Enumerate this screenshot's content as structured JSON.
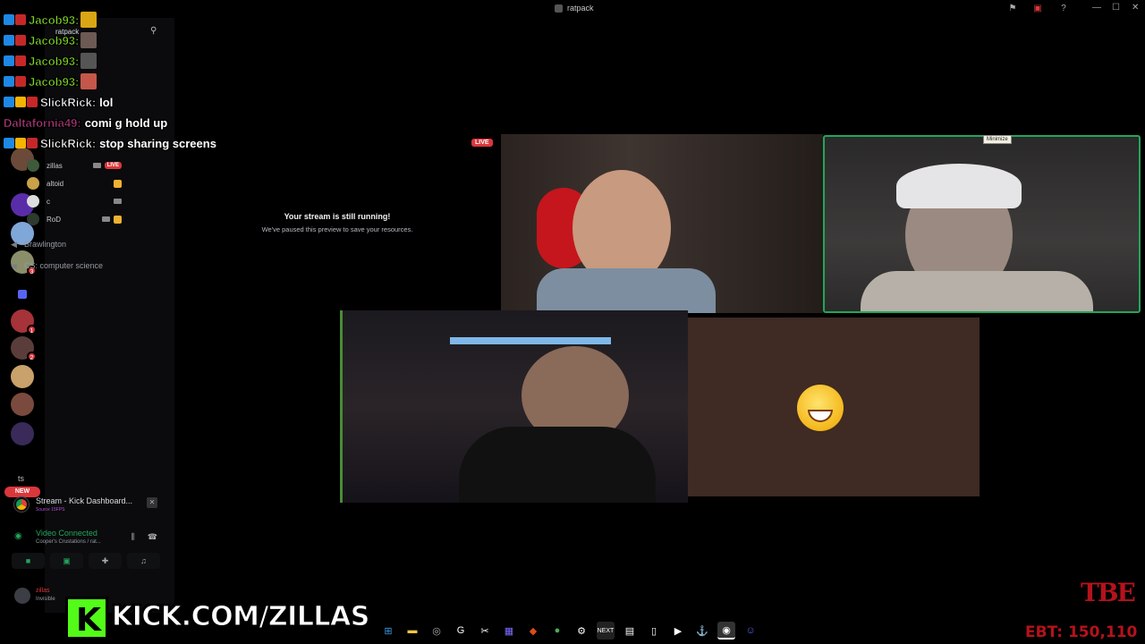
{
  "window": {
    "title": "ratpack"
  },
  "chat_overlay": {
    "lines": [
      {
        "name": "Jacob93:",
        "name_color": "#7ed321",
        "message": "",
        "emote": true
      },
      {
        "name": "Jacob93:",
        "name_color": "#7ed321",
        "message": "",
        "emote": true
      },
      {
        "name": "Jacob93:",
        "name_color": "#7ed321",
        "message": "",
        "emote": true
      },
      {
        "name": "Jacob93:",
        "name_color": "#7ed321",
        "message": "",
        "emote": true
      },
      {
        "name": "SlickRick:",
        "name_color": "#ffffff",
        "message": "lol",
        "emote": false
      },
      {
        "name": "Daltafornia49:",
        "name_color": "#b03a7a",
        "message": "comi g hold up",
        "emote": false
      },
      {
        "name": "SlickRick:",
        "name_color": "#ffffff",
        "message": "stop sharing screens",
        "emote": false
      }
    ]
  },
  "sidebar": {
    "header_title": "ratpack",
    "voice_users": [
      {
        "name": "zillas",
        "live": true,
        "live_label": "LIVE"
      },
      {
        "name": "altoid",
        "live": false
      },
      {
        "name": "c",
        "live": false
      },
      {
        "name": "RoD",
        "live": false
      }
    ],
    "channels": [
      {
        "name": "Brawlington"
      },
      {
        "name": "CS: computer science"
      }
    ]
  },
  "rail": {
    "new_label": "NEW",
    "folder_label": "ts"
  },
  "stream_panel": {
    "title": "Stream - Kick Dashboard...",
    "subtitle": "Source 15FPS"
  },
  "voice_panel": {
    "status": "Video Connected",
    "location": "Cooper's Crustations / rat..."
  },
  "user_panel": {
    "name": "zillas",
    "status": "Invisible"
  },
  "stage": {
    "live_label": "LIVE",
    "paused_title": "Your stream is still running!",
    "paused_subtitle": "We've paused this preview to save your resources.",
    "minimize_tooltip": "Minimize"
  },
  "overlay_brand": {
    "kick_url": "KICK.COM/ZILLAS",
    "kick_letter": "K",
    "tbe": "TBE",
    "ebt": "EBT: 150,110"
  },
  "colors": {
    "accent_green": "#23a55a",
    "live_red": "#da373c",
    "kick_green": "#53fc18"
  }
}
